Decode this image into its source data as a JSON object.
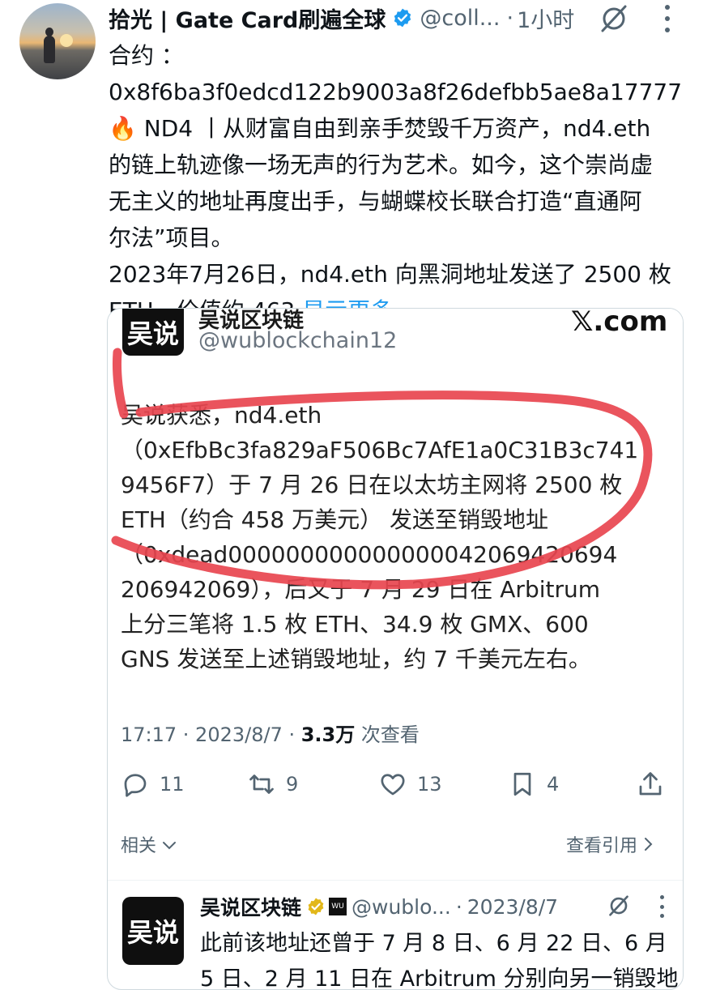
{
  "post": {
    "author_name": "拾光 | Gate Card刷遍全球",
    "handle": "@coll...",
    "separator": "·",
    "time": "1小时",
    "body_lines": [
      "合约 ：",
      "0x8f6ba3f0edcd122b9003a8f26defbb5ae8a17777",
      "ND4 丨从财富自由到亲手焚毁千万资产，nd4.eth",
      "的链上轨迹像一场无声的行为艺术。如今，这个崇尚虚",
      "无主义的地址再度出手，与蝴蝶校长联合打造“直通阿",
      "尔法”项目。",
      "2023年7月26日，nd4.eth 向黑洞地址发送了 2500 枚",
      "ETH，价值约 463"
    ],
    "fire_emoji": "🔥",
    "show_more": "显示更多"
  },
  "quoted_image": {
    "logo_text": "吴说",
    "name": "吴说区块链",
    "handle": "@wublockchain12",
    "site": "𝕏.com",
    "lines": [
      "吴说获悉，nd4.eth",
      "（0xEfbBc3fa829aF506Bc7AfE1a0C31B3c741",
      "9456F7）于 7 月 26 日在以太坊主网将 2500 枚",
      "ETH（约合 458 万美元） 发送至销毁地址",
      "（0xdead000000000000000042069420694",
      "206942069），后又于 7 月 29 日在 Arbitrum",
      "上分三笔将 1.5 枚 ETH、34.9 枚 GMX、600",
      "GNS 发送至上述销毁地址，约 7 千美元左右。"
    ],
    "meta_time": "17:17 · 2023/8/7 · ",
    "meta_views": "3.3万",
    "meta_views_label": " 次查看",
    "replies": "11",
    "retweets": "9",
    "likes": "13",
    "bookmarks": "4",
    "related": "相关",
    "view_quotes": "查看引用"
  },
  "quote_tweet": {
    "logo_text": "吴说",
    "name": "吴说区块链",
    "handle": "@wublo...",
    "separator": "·",
    "date": "2023/8/7",
    "badge_text": "WU",
    "lines": [
      "此前该地址还曾于 7 月 8 日、6 月 22 日、6 月",
      "5 日、2 月 11 日在 Arbitrum 分别向另一销毁地"
    ]
  },
  "colors": {
    "text": "#0f1419",
    "secondary": "#536471",
    "link": "#1d9bf0",
    "scribble": "#e8454f",
    "verified_blue": "#1d9bf0",
    "verified_gold": "#e2b719"
  }
}
